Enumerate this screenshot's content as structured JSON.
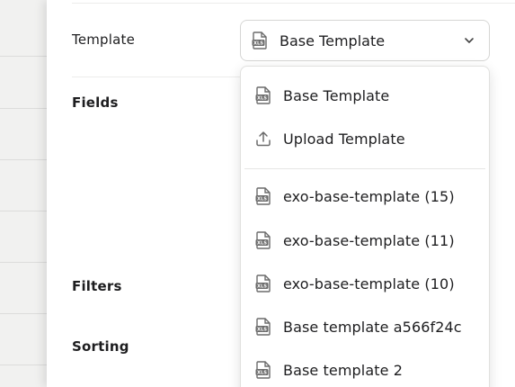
{
  "form": {
    "template_label": "Template",
    "fields_label": "Fields",
    "filters_label": "Filters",
    "sorting_label": "Sorting"
  },
  "select": {
    "value": "Base Template",
    "icon": "xls-file-icon"
  },
  "menu": {
    "items": [
      {
        "label": "Base Template",
        "icon": "xls-file-icon"
      },
      {
        "label": "Upload Template",
        "icon": "upload-icon"
      },
      {
        "label": "exo-base-template (15)",
        "icon": "xls-file-icon"
      },
      {
        "label": "exo-base-template (11)",
        "icon": "xls-file-icon"
      },
      {
        "label": "exo-base-template (10)",
        "icon": "xls-file-icon"
      },
      {
        "label": "Base template a566f24c",
        "icon": "xls-file-icon"
      },
      {
        "label": "Base template 2",
        "icon": "xls-file-icon"
      }
    ]
  },
  "colors": {
    "text": "#1d1d1f",
    "icon": "#6b6b6b",
    "border": "#d6d6d4"
  }
}
